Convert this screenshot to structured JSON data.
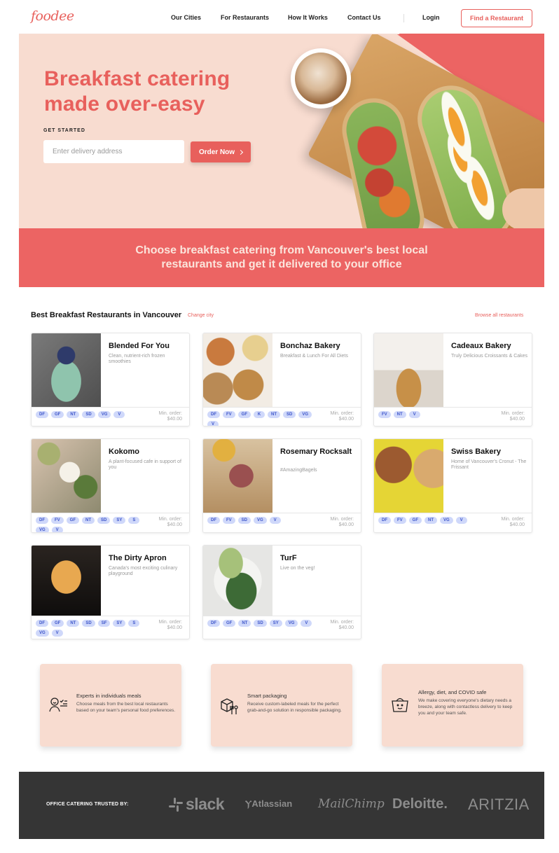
{
  "nav": {
    "logo": "foodee",
    "links": [
      "Our Cities",
      "For Restaurants",
      "How It Works",
      "Contact Us"
    ],
    "login": "Login",
    "cta": "Find a Restaurant"
  },
  "hero": {
    "title_line1": "Breakfast catering",
    "title_line2": "made over-easy",
    "kicker": "GET STARTED",
    "address_placeholder": "Enter delivery address",
    "address_value": "",
    "order_button": "Order Now",
    "image_alt": "breakfast toasts with tomatoes and soft-boiled eggs on a wooden board with coffee"
  },
  "banner": {
    "text": "Choose breakfast catering from Vancouver's best local restaurants and get it delivered to your office"
  },
  "section": {
    "title": "Best Breakfast Restaurants in Vancouver",
    "change_city": "Change city",
    "browse_all": "Browse all restaurants"
  },
  "restaurants": [
    {
      "name": "Blended For You",
      "description": "Clean, nutrient-rich frozen smoothies",
      "tags": [
        "DF",
        "GF",
        "NT",
        "SD",
        "VG",
        "V"
      ],
      "min_label": "Min. order:",
      "min_value": "$40.00"
    },
    {
      "name": "Bonchaz Bakery",
      "description": "Breakfast & Lunch For All Diets",
      "tags": [
        "DF",
        "FV",
        "GF",
        "K",
        "NT",
        "SD",
        "VG",
        "V"
      ],
      "min_label": "Min. order:",
      "min_value": "$40.00"
    },
    {
      "name": "Cadeaux Bakery",
      "description": "Truly Delicious Croissants & Cakes",
      "tags": [
        "FV",
        "NT",
        "V"
      ],
      "min_label": "Min. order:",
      "min_value": "$40.00"
    },
    {
      "name": "Kokomo",
      "description": "A plant-focused cafe in support of you",
      "tags": [
        "DF",
        "FV",
        "GF",
        "NT",
        "SD",
        "SY",
        "S",
        "VG",
        "V"
      ],
      "min_label": "Min. order:",
      "min_value": "$40.00"
    },
    {
      "name": "Rosemary Rocksalt",
      "description": "#AmazingBagels",
      "tags": [
        "DF",
        "FV",
        "SD",
        "VG",
        "V"
      ],
      "min_label": "Min. order:",
      "min_value": "$40.00"
    },
    {
      "name": "Swiss Bakery",
      "description": "Home of Vancouver's Cronut - The Frissant",
      "tags": [
        "DF",
        "FV",
        "GF",
        "NT",
        "VG",
        "V"
      ],
      "min_label": "Min. order:",
      "min_value": "$40.00"
    },
    {
      "name": "The Dirty Apron",
      "description": "Canada's most exciting culinary playground",
      "tags": [
        "DF",
        "GF",
        "NT",
        "SD",
        "SF",
        "SY",
        "S",
        "VG",
        "V"
      ],
      "min_label": "Min. order:",
      "min_value": "$40.00"
    },
    {
      "name": "TurF",
      "description": "Live on the veg!",
      "tags": [
        "DF",
        "GF",
        "NT",
        "SD",
        "SY",
        "VG",
        "V"
      ],
      "min_label": "Min. order:",
      "min_value": "$40.00"
    }
  ],
  "features": [
    {
      "icon": "person-checklist-icon",
      "title": "Experts in individuals meals",
      "body": "Choose meals from the best local restaurants based on your team's personal food preferences."
    },
    {
      "icon": "package-utensils-icon",
      "title": "Smart packaging",
      "body": "Receive custom-labeled meals for the perfect grab-and-go solution in responsible packaging."
    },
    {
      "icon": "smiling-basket-icon",
      "title": "Allergy, diet, and COVID safe",
      "body": "We make covering everyone's dietary needs a breeze, along with contactless delivery to keep you and your team safe."
    }
  ],
  "footer": {
    "label": "OFFICE CATERING TRUSTED BY:",
    "brands": [
      "slack",
      "Atlassian",
      "MailChimp",
      "Deloitte.",
      "ARITZIA"
    ]
  },
  "colors": {
    "brand": "#e8605c",
    "banner": "#ec6463",
    "hero_bg": "#f8dcd0",
    "tag_bg": "#cfd8fa",
    "tag_text": "#3d55c9",
    "footer_bg": "#353535"
  }
}
